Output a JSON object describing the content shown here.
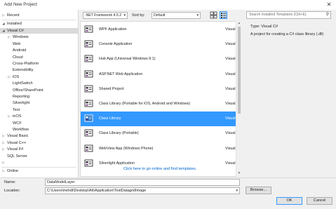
{
  "window": {
    "title": "Add New Project",
    "close_glyph": "✕"
  },
  "tree": {
    "recent": "Recent",
    "installed": "Installed",
    "items": [
      {
        "label": "Visual C#",
        "arrow": "◢",
        "selected": true
      },
      {
        "label": "Windows",
        "arrow": "▷"
      },
      {
        "label": "Web",
        "arrow": ""
      },
      {
        "label": "Android",
        "arrow": ""
      },
      {
        "label": "Cloud",
        "arrow": ""
      },
      {
        "label": "Cross-Platform",
        "arrow": ""
      },
      {
        "label": "Extensibility",
        "arrow": ""
      },
      {
        "label": "iOS",
        "arrow": "▷"
      },
      {
        "label": "LightSwitch",
        "arrow": ""
      },
      {
        "label": "Office/SharePoint",
        "arrow": ""
      },
      {
        "label": "Reporting",
        "arrow": ""
      },
      {
        "label": "Silverlight",
        "arrow": ""
      },
      {
        "label": "Test",
        "arrow": ""
      },
      {
        "label": "tvOS",
        "arrow": "▷"
      },
      {
        "label": "WCF",
        "arrow": ""
      },
      {
        "label": "Workflow",
        "arrow": ""
      },
      {
        "label": "Visual Basic",
        "arrow": "▷"
      },
      {
        "label": "Visual C++",
        "arrow": "▷"
      },
      {
        "label": "Visual F#",
        "arrow": "▷"
      },
      {
        "label": "SQL Server",
        "arrow": ""
      },
      {
        "label": "",
        "arrow": "▷"
      }
    ],
    "online": "Online"
  },
  "toolbar": {
    "framework": ".NET Framework 4.5.2",
    "sort_label": "Sort by:",
    "sort_value": "Default"
  },
  "search": {
    "placeholder": "Search Installed Templates (Ctrl+E)"
  },
  "templates": [
    {
      "name": "WPF Application",
      "lang": "Visual C#",
      "icon": "wpf-app-icon"
    },
    {
      "name": "Console Application",
      "lang": "Visual C#",
      "icon": "console-app-icon"
    },
    {
      "name": "Hub App (Universal Windows 8.1)",
      "lang": "Visual C#",
      "icon": "hub-app-icon"
    },
    {
      "name": "ASP.NET Web Application",
      "lang": "Visual C#",
      "icon": "web-app-icon"
    },
    {
      "name": "Shared Project",
      "lang": "Visual C#",
      "icon": "shared-project-icon"
    },
    {
      "name": "Class Library (Portable for iOS, Android and Windows)",
      "lang": "Visual C#",
      "icon": "portable-library-icon"
    },
    {
      "name": "Class Library",
      "lang": "Visual C#",
      "icon": "class-library-icon",
      "selected": true
    },
    {
      "name": "Class Library (Portable)",
      "lang": "Visual C#",
      "icon": "portable-class-library-icon"
    },
    {
      "name": "WebView App (Windows Phone)",
      "lang": "Visual C#",
      "icon": "webview-app-icon"
    },
    {
      "name": "Silverlight Application",
      "lang": "Visual C#",
      "icon": "silverlight-app-icon"
    }
  ],
  "online_link": "Click here to go online and find templates.",
  "details": {
    "type_label": "Type:",
    "type_value": "Visual C#",
    "description": "A project for creating a C# class library (.dll)"
  },
  "form": {
    "name_label": "Name:",
    "name_value": "DataModelLayer",
    "location_label": "Location:",
    "location_value": "C:\\Users\\mehdi\\Desktop\\Att\\Application\\TestDatagridImage",
    "browse_label": "Browse...",
    "ok_label": "OK",
    "cancel_label": "Cancel"
  },
  "colors": {
    "selection": "#3399ff",
    "link": "#0066cc"
  }
}
